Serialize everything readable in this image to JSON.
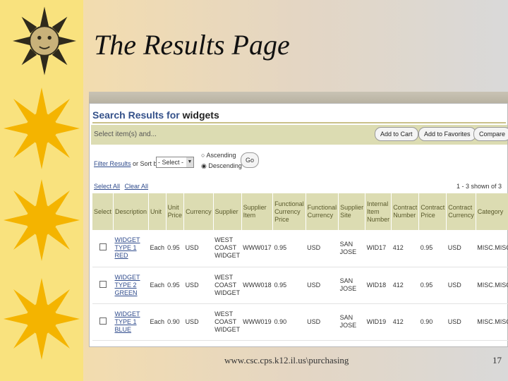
{
  "slide": {
    "title": "The Results Page",
    "footer_url": "www.csc.cps.k12.il.us\\purchasing",
    "page_number": "17"
  },
  "search": {
    "title_prefix": "Search Results for",
    "query": "widgets",
    "toolbar_label": "Select item(s) and...",
    "add_to_cart": "Add to Cart",
    "add_to_favorites": "Add to Favorites",
    "compare": "Compare",
    "filter_link": "Filter Results",
    "sort_label": "or Sort by",
    "sort_value": "- Select -",
    "ascending": "Ascending",
    "descending": "Descending",
    "go": "Go",
    "select_all": "Select All",
    "clear_all": "Clear All",
    "result_count": "1 - 3 shown of 3"
  },
  "table": {
    "headers": [
      "Select",
      "Description",
      "Unit",
      "Unit Price",
      "Currency",
      "Supplier",
      "Supplier Item",
      "Functional Currency Price",
      "Functional Currency",
      "Supplier Site",
      "Internal Item Number",
      "Contract Number",
      "Contract Price",
      "Contract Currency",
      "Category"
    ],
    "rows": [
      [
        "",
        "WIDGET TYPE 1 RED",
        "Each",
        "0.95",
        "USD",
        "WEST COAST WIDGET",
        "WWW017",
        "0.95",
        "USD",
        "SAN JOSE",
        "WID17",
        "412",
        "0.95",
        "USD",
        "MISC.MISC"
      ],
      [
        "",
        "WIDGET TYPE 2 GREEN",
        "Each",
        "0.95",
        "USD",
        "WEST COAST WIDGET",
        "WWW018",
        "0.95",
        "USD",
        "SAN JOSE",
        "WID18",
        "412",
        "0.95",
        "USD",
        "MISC.MISC"
      ],
      [
        "",
        "WIDGET TYPE 1 BLUE",
        "Each",
        "0.90",
        "USD",
        "WEST COAST WIDGET",
        "WWW019",
        "0.90",
        "USD",
        "SAN JOSE",
        "WID19",
        "412",
        "0.90",
        "USD",
        "MISC.MISC"
      ]
    ]
  },
  "icons": [
    "sun-face-icon",
    "sun-icon"
  ]
}
